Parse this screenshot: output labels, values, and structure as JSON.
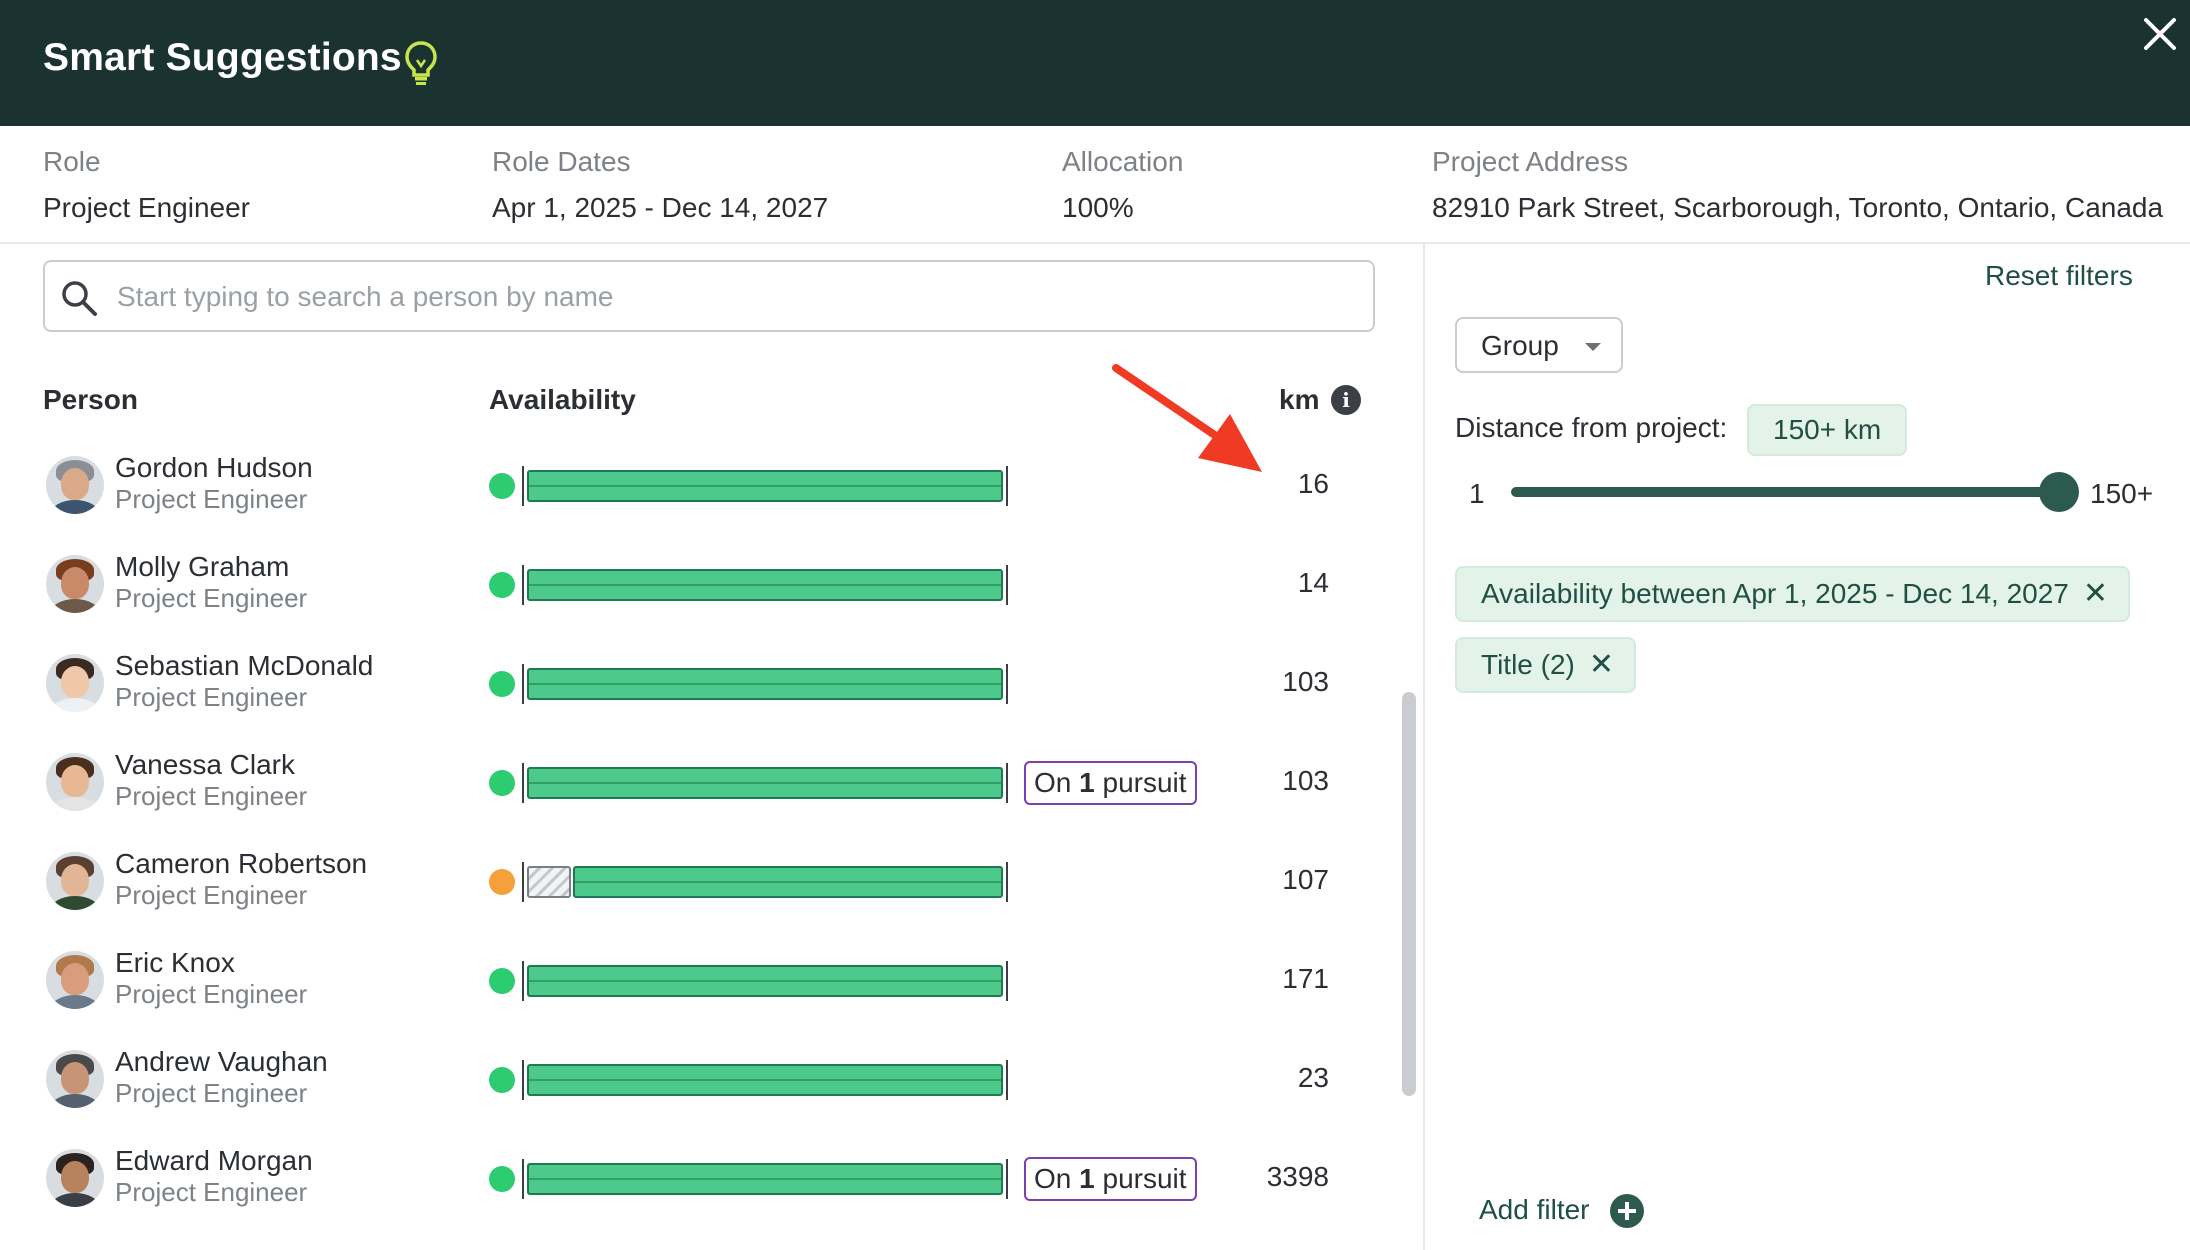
{
  "header": {
    "title": "Smart Suggestions",
    "icon": "lightbulb-icon",
    "close_icon": "close-icon",
    "background_color": "#1a3230",
    "icon_color": "#c8e64c"
  },
  "role_info": {
    "role_label": "Role",
    "role_value": "Project Engineer",
    "dates_label": "Role Dates",
    "dates_value": "Apr 1, 2025 - Dec 14, 2027",
    "allocation_label": "Allocation",
    "allocation_value": "100%",
    "address_label": "Project Address",
    "address_value": "82910 Park Street, Scarborough, Toronto, Ontario, Canada"
  },
  "search": {
    "placeholder": "Start typing to search a person by name",
    "value": ""
  },
  "columns": {
    "person": "Person",
    "availability": "Availability",
    "km": "km"
  },
  "people": [
    {
      "name": "Gordon Hudson",
      "title": "Project Engineer",
      "status": "available",
      "status_color": "#2ecc71",
      "partial": false,
      "pursuit": null,
      "km": "16"
    },
    {
      "name": "Molly Graham",
      "title": "Project Engineer",
      "status": "available",
      "status_color": "#2ecc71",
      "partial": false,
      "pursuit": null,
      "km": "14"
    },
    {
      "name": "Sebastian McDonald",
      "title": "Project Engineer",
      "status": "available",
      "status_color": "#2ecc71",
      "partial": false,
      "pursuit": null,
      "km": "103"
    },
    {
      "name": "Vanessa Clark",
      "title": "Project Engineer",
      "status": "available",
      "status_color": "#2ecc71",
      "partial": false,
      "pursuit": {
        "prefix": "On ",
        "count": "1",
        "suffix": " pursuit"
      },
      "km": "103"
    },
    {
      "name": "Cameron Robertson",
      "title": "Project Engineer",
      "status": "partial",
      "status_color": "#f5a03a",
      "partial": true,
      "pursuit": null,
      "km": "107"
    },
    {
      "name": "Eric Knox",
      "title": "Project Engineer",
      "status": "available",
      "status_color": "#2ecc71",
      "partial": false,
      "pursuit": null,
      "km": "171"
    },
    {
      "name": "Andrew Vaughan",
      "title": "Project Engineer",
      "status": "available",
      "status_color": "#2ecc71",
      "partial": false,
      "pursuit": null,
      "km": "23"
    },
    {
      "name": "Edward Morgan",
      "title": "Project Engineer",
      "status": "available",
      "status_color": "#2ecc71",
      "partial": false,
      "pursuit": {
        "prefix": "On ",
        "count": "1",
        "suffix": " pursuit"
      },
      "km": "3398"
    }
  ],
  "filters": {
    "reset_label": "Reset filters",
    "group_label": "Group",
    "distance_label": "Distance from project:",
    "distance_chip": "150+ km",
    "slider_min": "1",
    "slider_max": "150+",
    "slider_value_fraction": 1.0,
    "active": [
      {
        "label": "Availability between Apr 1, 2025 - Dec 14, 2027"
      },
      {
        "label": "Title (2)"
      }
    ],
    "add_filter_label": "Add filter"
  },
  "colors": {
    "accent": "#1f4f45",
    "available_bar": "#4cc98b",
    "pursuit_border": "#7b3fb2",
    "chip_bg": "#e4f3ea",
    "annotation_arrow": "#f03a23"
  }
}
